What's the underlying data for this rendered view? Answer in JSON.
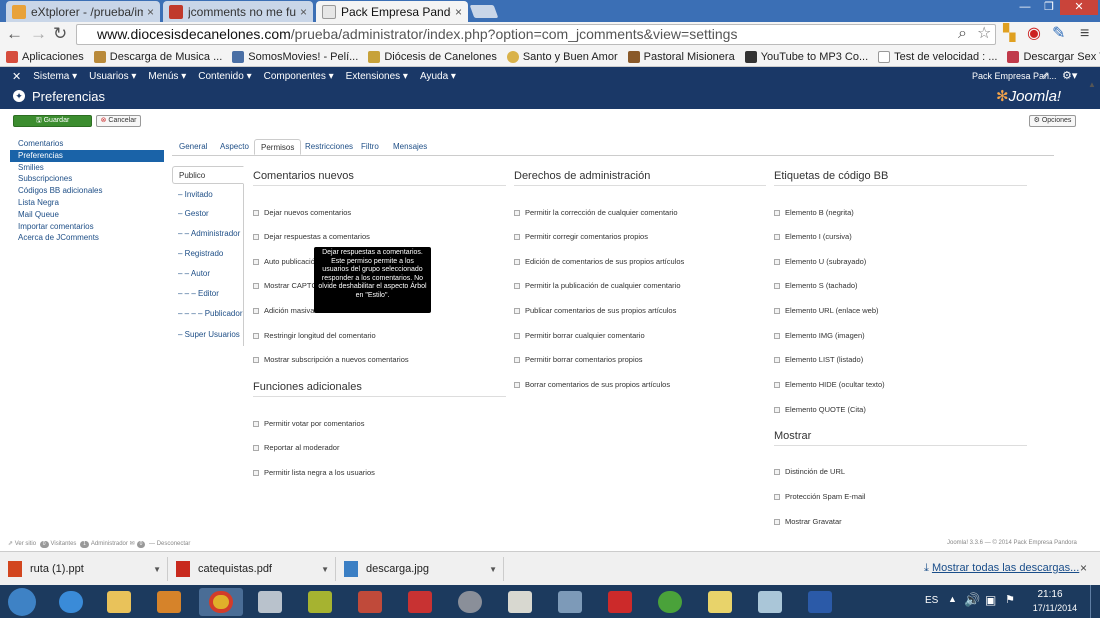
{
  "browser": {
    "tabs": [
      {
        "title": "eXtplorer - /prueba/imag",
        "close": "×"
      },
      {
        "title": "jcomments no me funcio",
        "close": "×"
      },
      {
        "title": "Pack Empresa Pandora - A",
        "close": "×"
      }
    ],
    "window_controls": {
      "minimize": "—",
      "maximize": "❐",
      "close": "✕"
    },
    "url_domain": "www.diocesisdecanelones.com",
    "url_path": "/prueba/administrator/index.php?option=com_jcomments&view=settings",
    "bookmarks": [
      "Aplicaciones",
      "Descarga de Musica ...",
      "SomosMovies! - Pelí...",
      "Diócesis de Canelones",
      "Santo y Buen Amor",
      "Pastoral Misionera",
      "YouTube to MP3 Co...",
      "Test de velocidad : ...",
      "Descargar Sex Tape ..."
    ]
  },
  "joomla": {
    "menu": [
      "Sistema ▾",
      "Usuarios ▾",
      "Menús ▾",
      "Contenido ▾",
      "Componentes ▾",
      "Extensiones ▾",
      "Ayuda ▾"
    ],
    "site_name": "Pack Empresa Pan...",
    "page_title": "Preferencias",
    "brand": "Joomla!",
    "toolbar": {
      "save": "Guardar",
      "cancel": "Cancelar",
      "options": "Opciones"
    },
    "sidebar": [
      "Comentarios",
      "Preferencias",
      "Smilies",
      "Subscripciones",
      "Códigos BB adicionales",
      "Lista Negra",
      "Mail Queue",
      "Importar comentarios",
      "Acerca de JComments"
    ],
    "tabs": [
      "General",
      "Aspecto",
      "Permisos",
      "Restricciones",
      "Filtro",
      "Mensajes"
    ],
    "groups": [
      "Publico",
      "– Invitado",
      "– Gestor",
      "– – Administrador",
      "– Registrado",
      "– – Autor",
      "– – – Editor",
      "– – – – Publicador",
      "– Super Usuarios"
    ],
    "sections": {
      "new_comments": {
        "title": "Comentarios nuevos",
        "items": [
          "Dejar nuevos comentarios",
          "Dejar respuestas a comentarios",
          "Auto publicación",
          "Mostrar CAPTCHA",
          "Adición masiva de",
          "Restringir longitud del comentario",
          "Mostrar subscripción a nuevos comentarios"
        ]
      },
      "extra": {
        "title": "Funciones adicionales",
        "items": [
          "Permitir votar por comentarios",
          "Reportar al moderador",
          "Permitir lista negra a los usuarios"
        ]
      },
      "admin": {
        "title": "Derechos de administración",
        "items": [
          "Permitir la corrección de cualquier comentario",
          "Permitir corregir comentarios propios",
          "Edición de comentarios de sus propios artículos",
          "Permitir la publicación de cualquier comentario",
          "Publicar comentarios de sus propios artículos",
          "Permitir borrar cualquier comentario",
          "Permitir borrar comentarios propios",
          "Borrar comentarios de sus propios artículos"
        ]
      },
      "bbcode": {
        "title": "Etiquetas de código BB",
        "items": [
          "Elemento B (negrita)",
          "Elemento I (cursiva)",
          "Elemento U (subrayado)",
          "Elemento S (tachado)",
          "Elemento URL (enlace web)",
          "Elemento IMG (imagen)",
          "Elemento LIST (listado)",
          "Elemento HIDE (ocultar texto)",
          "Elemento QUOTE (Cita)"
        ]
      },
      "show": {
        "title": "Mostrar",
        "items": [
          "Distinción de URL",
          "Protección Spam E-mail",
          "Mostrar Gravatar"
        ]
      }
    },
    "tooltip": "Dejar respuestas a comentarios. Este permiso permite a los usuarios del grupo seleccionado responder a los comentarios. No olvide deshabilitar el aspecto Árbol en \"Estilo\".",
    "status": {
      "view_site": "Ver sitio",
      "visitors_count": "0",
      "visitors_label": "Visitantes",
      "admins_count": "1",
      "admins_label": "Administrador",
      "x_count": "0",
      "logout": "Desconectar",
      "footer": "Joomla! 3.3.6 — © 2014 Pack Empresa Pandora"
    }
  },
  "downloads": {
    "items": [
      "ruta (1).ppt",
      "catequistas.pdf",
      "descarga.jpg"
    ],
    "show_all": "Mostrar todas las descargas...",
    "close": "×"
  },
  "taskbar": {
    "lang": "ES",
    "time": "21:16",
    "date": "17/11/2014"
  },
  "colors": {
    "joomla_bar": "#1a3867",
    "accent_blue": "#1a63a8",
    "save_green": "#3c8d2f",
    "browser_tabs_bg": "#3b6fb5",
    "taskbar_bg": "#1c3a5e"
  }
}
